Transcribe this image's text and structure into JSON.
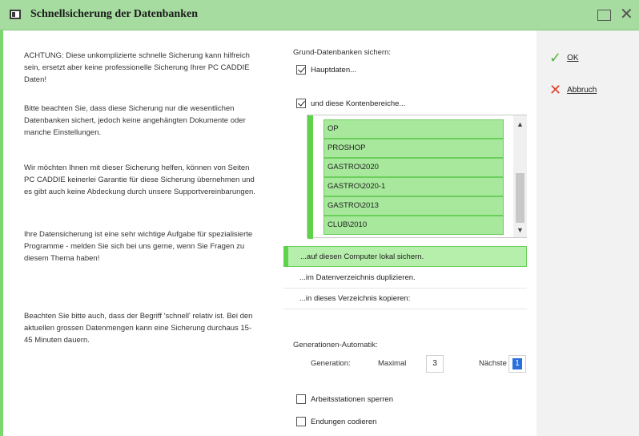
{
  "window": {
    "title": "Schnellsicherung der Datenbanken"
  },
  "info": {
    "p1": "ACHTUNG: Diese unkomplizierte schnelle Sicherung kann hilfreich sein, ersetzt aber keine professionelle Sicherung Ihrer PC CADDIE Daten!",
    "p2": "Bitte beachten Sie, dass diese Sicherung nur die wesentlichen Datenbanken sichert, jedoch keine angehängten Dokumente oder manche Einstellungen.",
    "p3": "Wir möchten Ihnen mit dieser Sicherung helfen, können von Seiten PC CADDIE keinerlei Garantie für diese Sicherung übernehmen und es gibt auch keine Abdeckung durch unsere Supportvereinbarungen.",
    "p4": "Ihre Datensicherung ist eine sehr wichtige Aufgabe für spezialisierte Programme - melden Sie sich bei uns gerne, wenn Sie Fragen zu diesem Thema haben!",
    "p5": "Beachten Sie bitte auch, dass der Begriff 'schnell' relativ ist. Bei den aktuellen grossen Datenmengen kann eine Sicherung durchaus 15-45 Minuten dauern."
  },
  "backup": {
    "heading": "Grund-Datenbanken sichern:",
    "hauptdaten": {
      "label": "Hauptdaten...",
      "checked": true
    },
    "kontenbereiche": {
      "label": "und diese Kontenbereiche...",
      "checked": true
    },
    "areas": [
      "OP",
      "PROSHOP",
      "GASTRO\\2020",
      "GASTRO\\2020-1",
      "GASTRO\\2013",
      "CLUB\\2010"
    ]
  },
  "destinations": [
    {
      "label": "...auf diesen Computer lokal sichern.",
      "selected": true
    },
    {
      "label": "...im Datenverzeichnis duplizieren.",
      "selected": false
    },
    {
      "label": "...in dieses Verzeichnis kopieren:",
      "selected": false
    }
  ],
  "generations": {
    "heading": "Generationen-Automatik:",
    "generation_label": "Generation:",
    "max_label": "Maximal",
    "max_value": "3",
    "next_label": "Nächste",
    "next_value": "1"
  },
  "options": {
    "lock_workstations": {
      "label": "Arbeitsstationen sperren",
      "checked": false
    },
    "encode_extensions": {
      "label": "Endungen codieren",
      "checked": false
    }
  },
  "actions": {
    "ok": "OK",
    "cancel": "Abbruch"
  },
  "colors": {
    "titlebar": "#a7dca0",
    "list_highlight": "#a7e89c",
    "accent_green": "#5fd24c",
    "ok_green": "#55b43b",
    "cancel_red": "#e0412e"
  }
}
